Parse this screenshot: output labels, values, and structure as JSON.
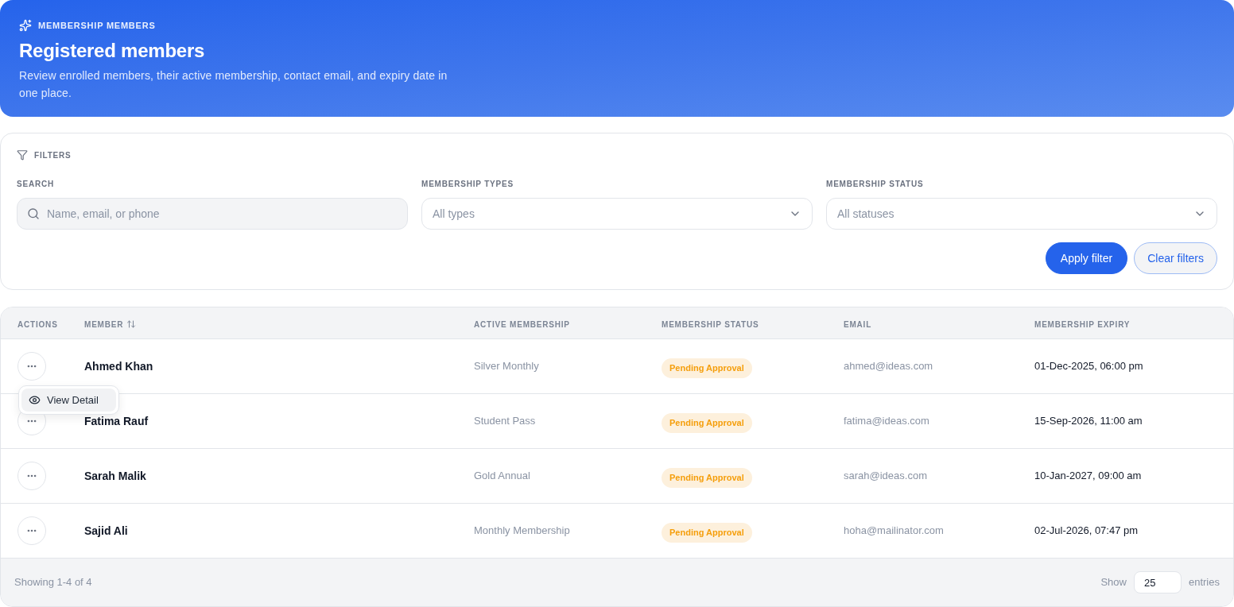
{
  "header": {
    "eyebrow": "MEMBERSHIP MEMBERS",
    "title": "Registered members",
    "description": "Review enrolled members, their active membership, contact email, and expiry date in one place."
  },
  "filters": {
    "title": "FILTERS",
    "fields": [
      {
        "kind": "search",
        "label": "SEARCH",
        "placeholder": "Name, email, or phone"
      },
      {
        "kind": "select",
        "label": "MEMBERSHIP TYPES",
        "value": "All types"
      },
      {
        "kind": "select",
        "label": "MEMBERSHIP STATUS",
        "value": "All statuses"
      }
    ],
    "buttons": [
      {
        "kind": "primary",
        "label": "Apply filter"
      },
      {
        "kind": "secondary",
        "label": "Clear filters"
      }
    ]
  },
  "table": {
    "columns": [
      {
        "label": "ACTIONS",
        "sortable": false
      },
      {
        "label": "MEMBER",
        "sortable": true
      },
      {
        "label": "ACTIVE MEMBERSHIP",
        "sortable": false
      },
      {
        "label": "MEMBERSHIP STATUS",
        "sortable": false
      },
      {
        "label": "EMAIL",
        "sortable": false
      },
      {
        "label": "MEMBERSHIP EXPIRY",
        "sortable": false
      }
    ],
    "rows": [
      {
        "name": "Ahmed Khan",
        "membership": "Silver Monthly",
        "status": "Pending Approval",
        "email": "ahmed@ideas.com",
        "expiry": "01-Dec-2025, 06:00 pm",
        "menu_open": true
      },
      {
        "name": "Fatima Rauf",
        "membership": "Student Pass",
        "status": "Pending Approval",
        "email": "fatima@ideas.com",
        "expiry": "15-Sep-2026, 11:00 am",
        "menu_open": false
      },
      {
        "name": "Sarah Malik",
        "membership": "Gold Annual",
        "status": "Pending Approval",
        "email": "sarah@ideas.com",
        "expiry": "10-Jan-2027, 09:00 am",
        "menu_open": false
      },
      {
        "name": "Sajid Ali",
        "membership": "Monthly Membership",
        "status": "Pending Approval",
        "email": "hoha@mailinator.com",
        "expiry": "02-Jul-2026, 07:47 pm",
        "menu_open": false
      }
    ],
    "row_menu": {
      "items": [
        {
          "label": "View Detail",
          "highlighted": true
        }
      ]
    }
  },
  "footer": {
    "summary": "Showing 1-4 of 4",
    "show_label": "Show",
    "page_size": "25",
    "entries_label": "entries"
  }
}
